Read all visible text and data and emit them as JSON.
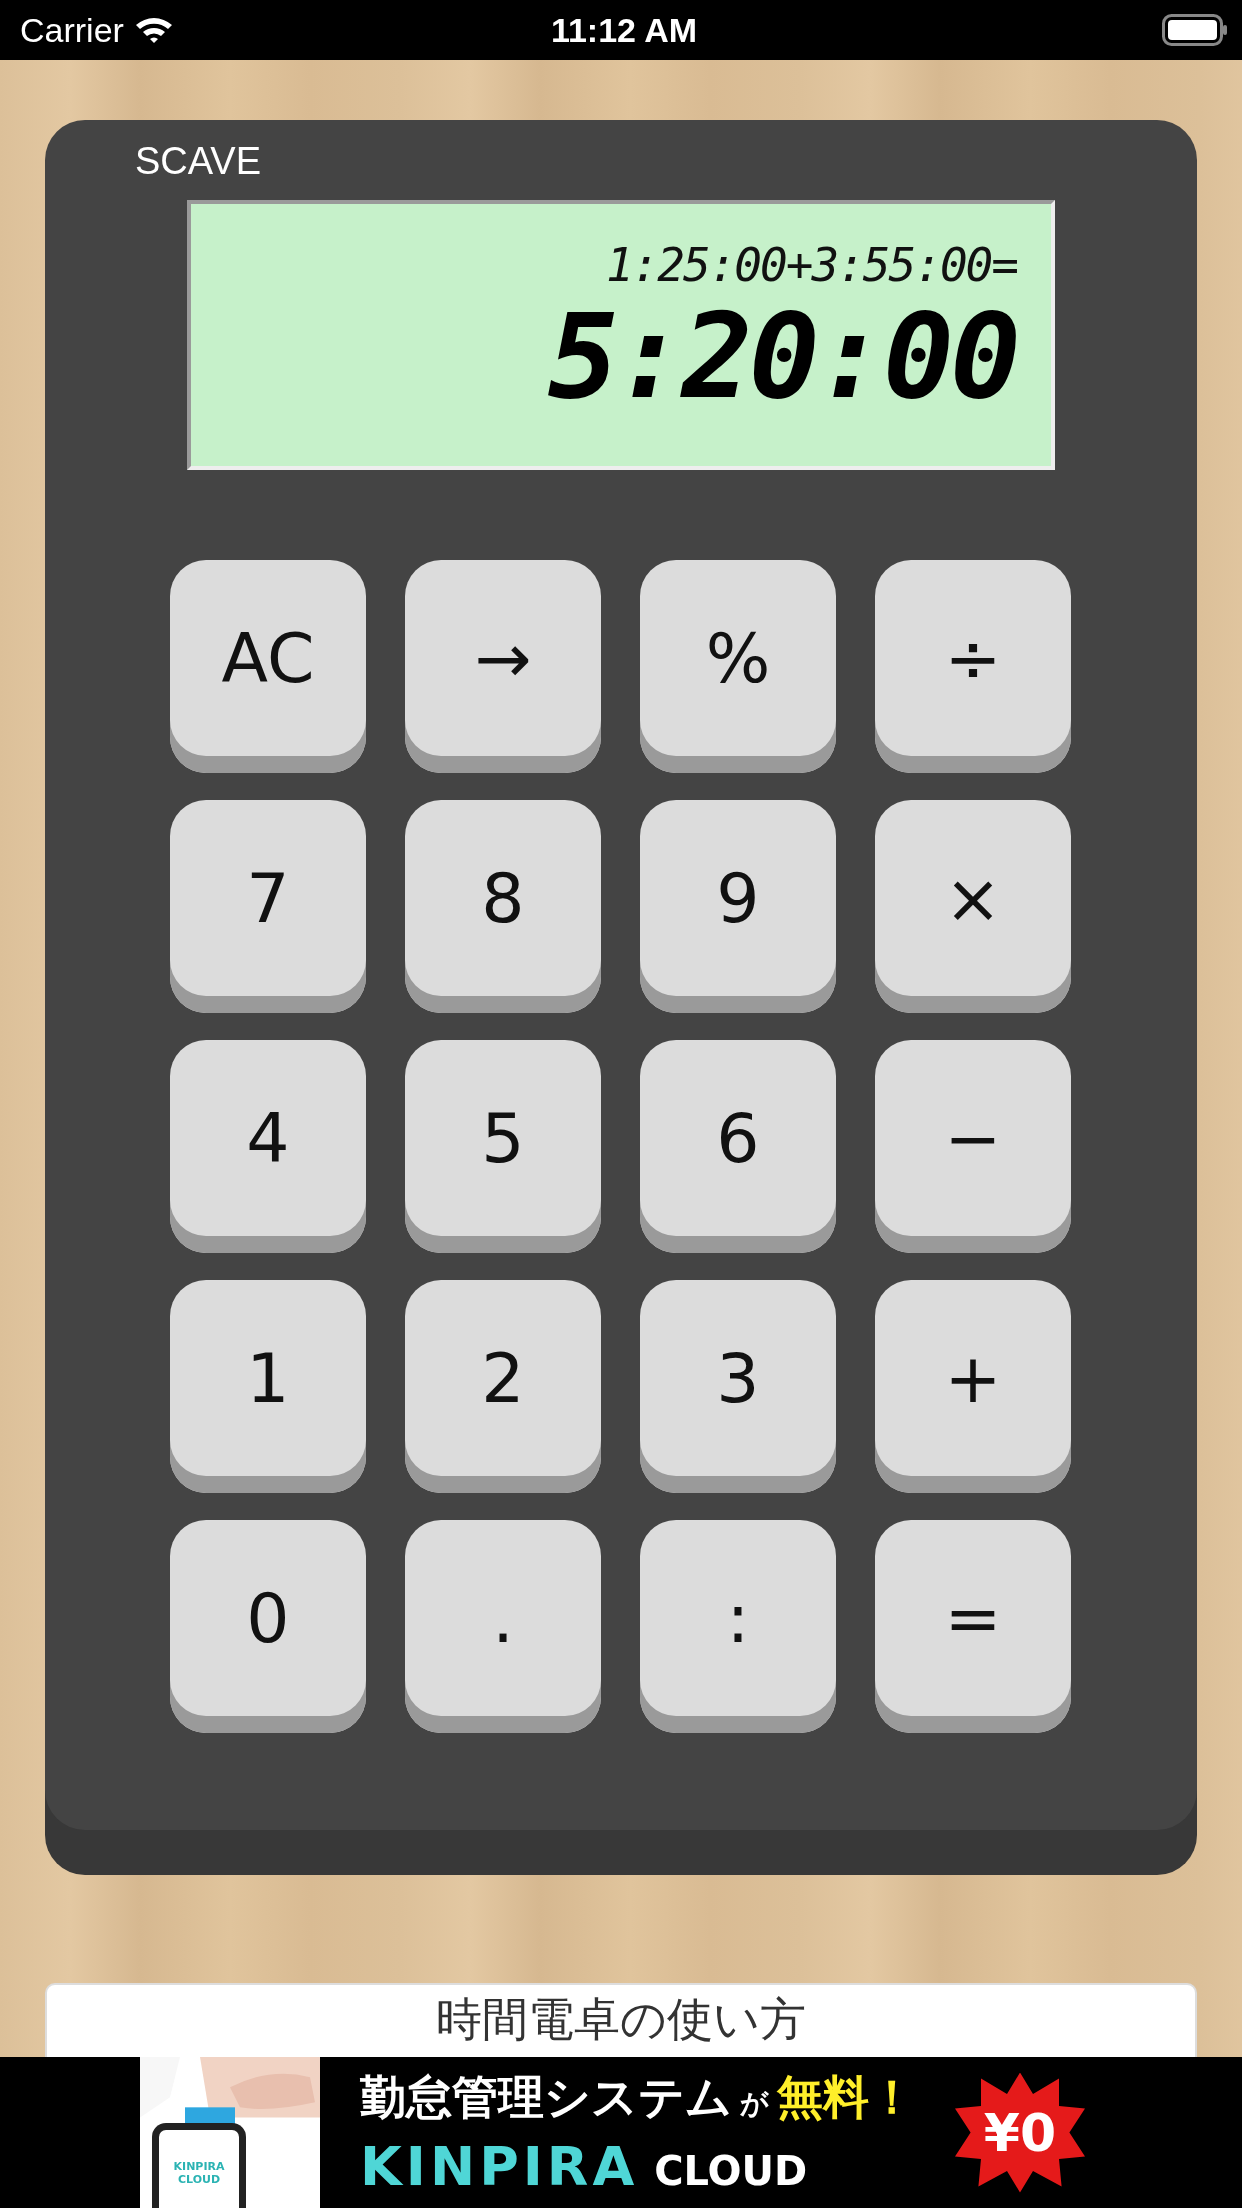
{
  "status_bar": {
    "carrier": "Carrier",
    "time": "11:12 AM"
  },
  "calculator": {
    "brand": "SCAVE",
    "display": {
      "expression": "1:25:00+3:55:00=",
      "result": "5:20:00"
    },
    "keys": [
      {
        "label": "AC"
      },
      {
        "label": "→"
      },
      {
        "label": "%"
      },
      {
        "label": "÷"
      },
      {
        "label": "7"
      },
      {
        "label": "8"
      },
      {
        "label": "9"
      },
      {
        "label": "×"
      },
      {
        "label": "4"
      },
      {
        "label": "5"
      },
      {
        "label": "6"
      },
      {
        "label": "−"
      },
      {
        "label": "1"
      },
      {
        "label": "2"
      },
      {
        "label": "3"
      },
      {
        "label": "+"
      },
      {
        "label": "0"
      },
      {
        "label": "."
      },
      {
        "label": ":"
      },
      {
        "label": "="
      }
    ]
  },
  "help_card": {
    "title": "時間電卓の使い方"
  },
  "ad": {
    "phone_text": "KINPIRA CLOUD",
    "headline": "勤怠管理システム",
    "particle": "が",
    "highlight": "無料！",
    "brand": "KINPIRA",
    "brand_suffix": "CLOUD",
    "price": "¥0"
  }
}
